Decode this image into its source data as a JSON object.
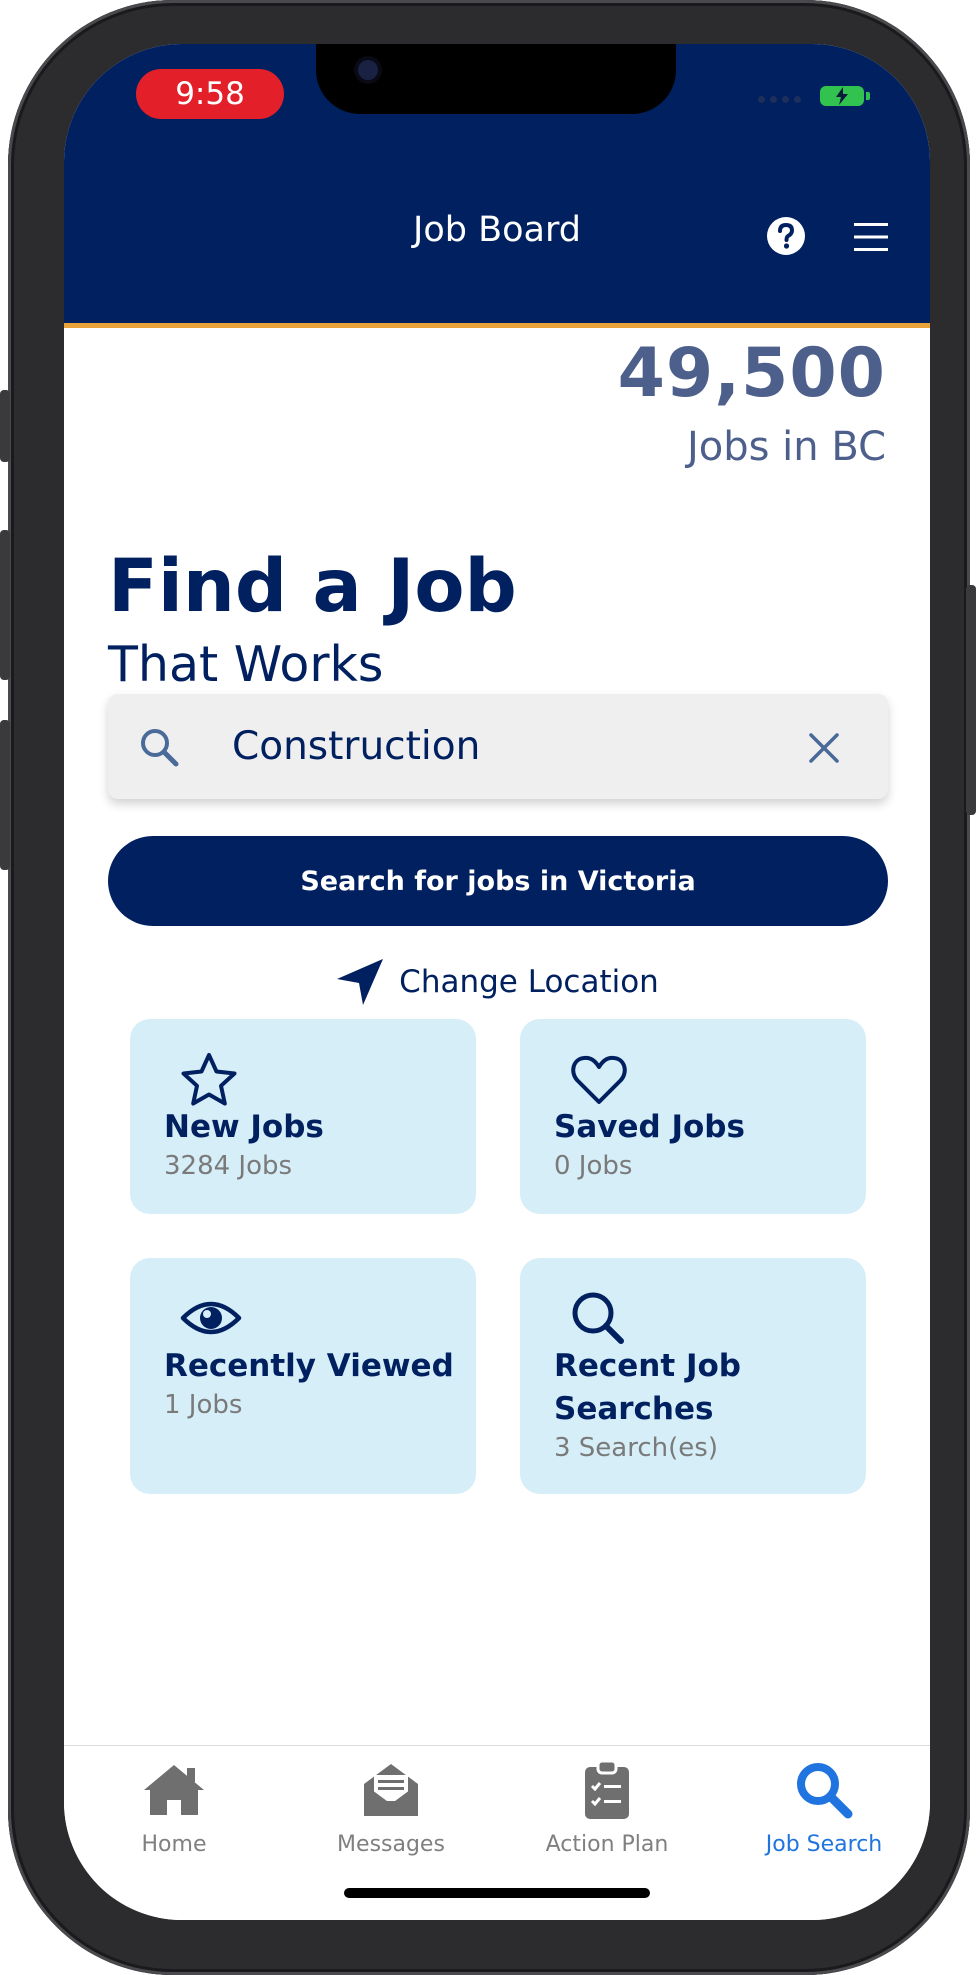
{
  "status_bar": {
    "time": "9:58"
  },
  "header": {
    "title": "Job Board",
    "help_icon": "help-circle-icon",
    "menu_icon": "hamburger-menu-icon"
  },
  "stats": {
    "count": "49,500",
    "label": "Jobs in BC"
  },
  "hero": {
    "title": "Find a Job",
    "subtitle": "That Works"
  },
  "search": {
    "value": "Construction",
    "button_label": "Search for jobs in Victoria"
  },
  "location": {
    "label": "Change Location",
    "icon": "location-arrow-icon"
  },
  "tiles": [
    {
      "name": "New Jobs",
      "count": "3284 Jobs",
      "icon": "star-icon"
    },
    {
      "name": "Saved Jobs",
      "count": "0 Jobs",
      "icon": "heart-icon"
    },
    {
      "name": "Recently Viewed",
      "count": "1 Jobs",
      "icon": "eye-icon"
    },
    {
      "name": "Recent Job Searches",
      "count": "3 Search(es)",
      "icon": "search-icon"
    }
  ],
  "tabbar": {
    "items": [
      {
        "label": "Home",
        "icon": "home-icon",
        "active": false
      },
      {
        "label": "Messages",
        "icon": "envelope-open-icon",
        "active": false
      },
      {
        "label": "Action Plan",
        "icon": "clipboard-check-icon",
        "active": false
      },
      {
        "label": "Job Search",
        "icon": "search-icon",
        "active": true
      }
    ]
  },
  "colors": {
    "navy": "#012060",
    "accent_orange": "#e8a43a",
    "tile_bg": "#d6eef8",
    "active_tab": "#1f74e0",
    "time_pill": "#e3202a"
  }
}
